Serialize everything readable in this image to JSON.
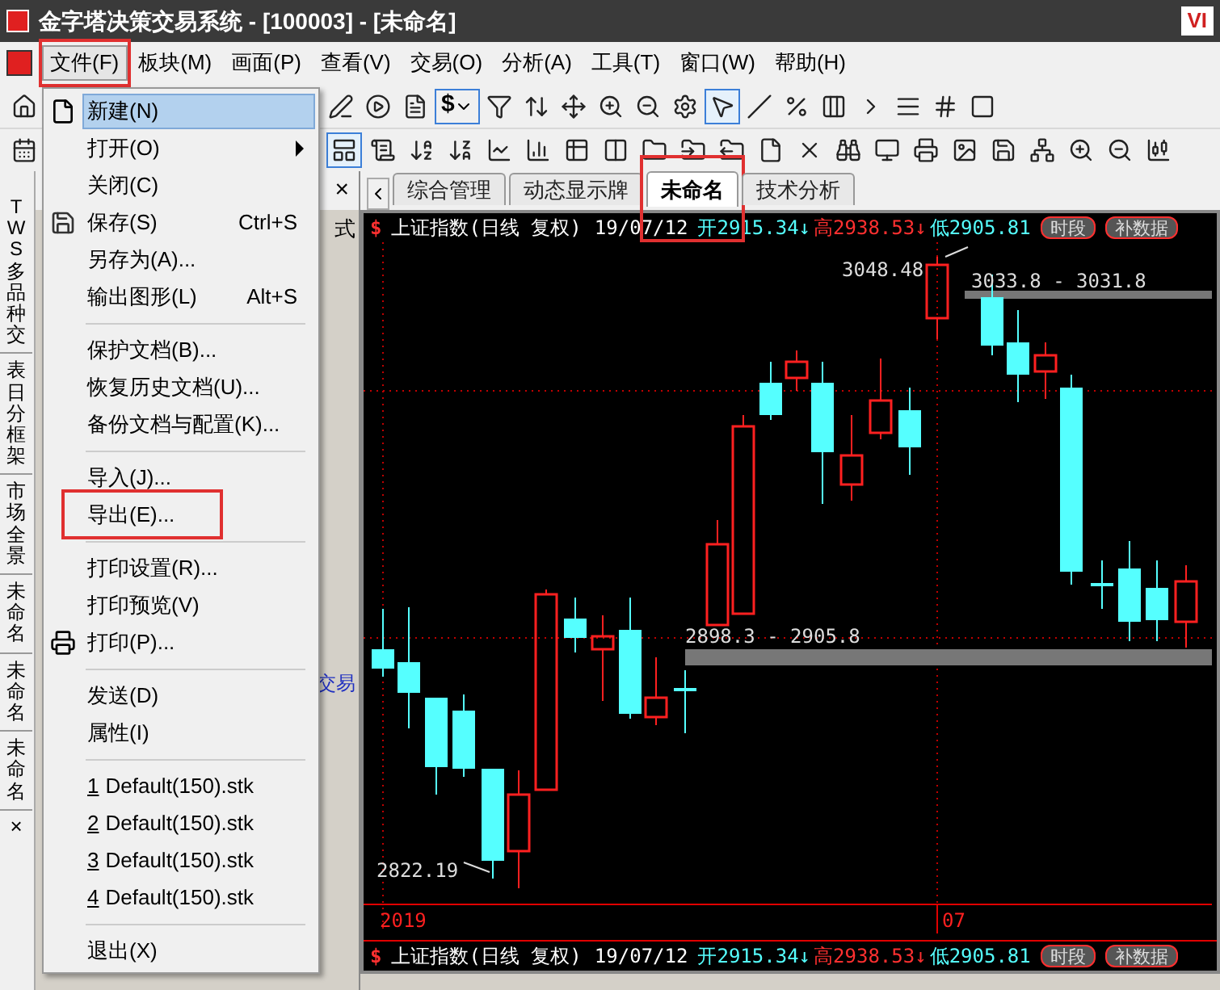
{
  "window": {
    "title": "金字塔决策交易系统 - [100003] - [未命名]",
    "corner_badge": "VI"
  },
  "menu_bar": [
    {
      "label": "文件(F)",
      "open": true,
      "highlighted": true
    },
    {
      "label": "板块(M)",
      "open": false,
      "highlighted": false
    },
    {
      "label": "画面(P)",
      "open": false,
      "highlighted": false
    },
    {
      "label": "查看(V)",
      "open": false,
      "highlighted": false
    },
    {
      "label": "交易(O)",
      "open": false,
      "highlighted": false
    },
    {
      "label": "分析(A)",
      "open": false,
      "highlighted": false
    },
    {
      "label": "工具(T)",
      "open": false,
      "highlighted": false
    },
    {
      "label": "窗口(W)",
      "open": false,
      "highlighted": false
    },
    {
      "label": "帮助(H)",
      "open": false,
      "highlighted": false
    }
  ],
  "toolbar": {
    "currency_button": "$"
  },
  "file_menu": [
    {
      "kind": "new",
      "label": "新建(N)",
      "selected": true,
      "highlighted": false
    },
    {
      "kind": "submenu",
      "label": "打开(O)",
      "selected": false,
      "highlighted": false
    },
    {
      "kind": "item",
      "label": "关闭(C)",
      "selected": false,
      "highlighted": false
    },
    {
      "kind": "save",
      "label": "保存(S)",
      "shortcut": "Ctrl+S",
      "selected": false,
      "highlighted": false
    },
    {
      "kind": "item",
      "label": "另存为(A)...",
      "selected": false,
      "highlighted": false
    },
    {
      "kind": "item",
      "label": "输出图形(L)",
      "shortcut": "Alt+S",
      "selected": false,
      "highlighted": false
    },
    {
      "kind": "separator"
    },
    {
      "kind": "item",
      "label": "保护文档(B)...",
      "selected": false,
      "highlighted": false
    },
    {
      "kind": "item",
      "label": "恢复历史文档(U)...",
      "selected": false,
      "highlighted": false
    },
    {
      "kind": "item",
      "label": "备份文档与配置(K)...",
      "selected": false,
      "highlighted": false
    },
    {
      "kind": "separator"
    },
    {
      "kind": "item",
      "label": "导入(J)...",
      "selected": false,
      "highlighted": false
    },
    {
      "kind": "item",
      "label": "导出(E)...",
      "selected": false,
      "highlighted": true
    },
    {
      "kind": "separator"
    },
    {
      "kind": "item",
      "label": "打印设置(R)...",
      "selected": false,
      "highlighted": false
    },
    {
      "kind": "item",
      "label": "打印预览(V)",
      "selected": false,
      "highlighted": false
    },
    {
      "kind": "print",
      "label": "打印(P)...",
      "selected": false,
      "highlighted": false
    },
    {
      "kind": "separator"
    },
    {
      "kind": "item",
      "label": "发送(D)",
      "selected": false,
      "highlighted": false
    },
    {
      "kind": "item",
      "label": "属性(I)",
      "selected": false,
      "highlighted": false
    },
    {
      "kind": "separator"
    },
    {
      "kind": "recent",
      "number": "1",
      "label": "Default(150).stk",
      "selected": false,
      "highlighted": false
    },
    {
      "kind": "recent",
      "number": "2",
      "label": "Default(150).stk",
      "selected": false,
      "highlighted": false
    },
    {
      "kind": "recent",
      "number": "3",
      "label": "Default(150).stk",
      "selected": false,
      "highlighted": false
    },
    {
      "kind": "recent",
      "number": "4",
      "label": "Default(150).stk",
      "selected": false,
      "highlighted": false
    },
    {
      "kind": "separator"
    },
    {
      "kind": "item",
      "label": "退出(X)",
      "selected": false,
      "highlighted": false
    }
  ],
  "side_tabs": {
    "items": [
      "TWS多品种交",
      "表日分框架",
      "市场全景",
      "未命名",
      "未命名",
      "未命名"
    ],
    "close": "×"
  },
  "side_panel": {
    "close": "×",
    "text_top": "式",
    "text_link": "交易"
  },
  "tabs": [
    {
      "label": "综合管理",
      "selected": false,
      "highlighted": false
    },
    {
      "label": "动态显示牌",
      "selected": false,
      "highlighted": false
    },
    {
      "label": "未命名",
      "selected": true,
      "highlighted": true
    },
    {
      "label": "技术分析",
      "selected": false,
      "highlighted": false
    }
  ],
  "chart_header": {
    "mark": "$",
    "name": "上证指数(日线 复权)",
    "date": "19/07/12",
    "open": "开2915.34↓",
    "high": "高2938.53↓",
    "low": "低2905.81",
    "buttons": [
      "时段",
      "补数据"
    ]
  },
  "chart_labels": {
    "peak": "3048.48",
    "upper_zone": "3033.8 - 3031.8",
    "lower_zone": "2898.3 - 2905.8",
    "trough": "2822.19"
  },
  "axis": {
    "year": "2019",
    "month": "07"
  },
  "chart_footer": {
    "mark": "$",
    "name": "上证指数(日线 复权)",
    "date": "19/07/12",
    "open": "开2915.34↓",
    "high": "高2938.53↓",
    "low": "低2905.81",
    "buttons": [
      "时段",
      "补数据"
    ]
  }
}
